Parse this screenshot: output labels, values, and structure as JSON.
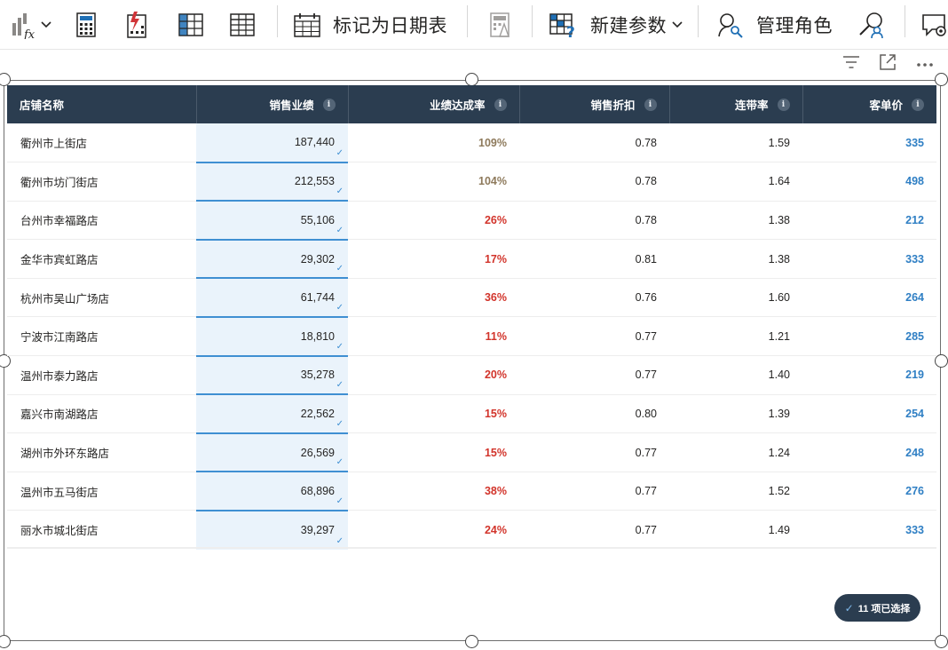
{
  "ribbon": {
    "mark_date_table_label": "标记为日期表",
    "new_param_label": "新建参数",
    "manage_roles_label": "管理角色",
    "icons": [
      "new-measure-fx-icon",
      "calculator-icon",
      "quick-measure-icon",
      "new-column-icon",
      "new-table-icon",
      "calendar-table-icon",
      "what-if-icon",
      "parameter-icon",
      "manage-roles-icon",
      "view-as-icon",
      "q-and-a-setup-icon"
    ]
  },
  "visual_header": {
    "icons": [
      "filter-icon",
      "focus-mode-icon",
      "more-options-icon"
    ]
  },
  "table": {
    "columns": [
      "店铺名称",
      "销售业绩",
      "业绩达成率",
      "销售折扣",
      "连带率",
      "客单价"
    ],
    "rows": [
      {
        "store": "衢州市上街店",
        "sales": "187,440",
        "rate": "109%",
        "discount": "0.78",
        "attach": "1.59",
        "price": "335"
      },
      {
        "store": "衢州市坊门街店",
        "sales": "212,553",
        "rate": "104%",
        "discount": "0.78",
        "attach": "1.64",
        "price": "498"
      },
      {
        "store": "台州市幸福路店",
        "sales": "55,106",
        "rate": "26%",
        "discount": "0.78",
        "attach": "1.38",
        "price": "212"
      },
      {
        "store": "金华市宾虹路店",
        "sales": "29,302",
        "rate": "17%",
        "discount": "0.81",
        "attach": "1.38",
        "price": "333"
      },
      {
        "store": "杭州市吴山广场店",
        "sales": "61,744",
        "rate": "36%",
        "discount": "0.76",
        "attach": "1.60",
        "price": "264"
      },
      {
        "store": "宁波市江南路店",
        "sales": "18,810",
        "rate": "11%",
        "discount": "0.77",
        "attach": "1.21",
        "price": "285"
      },
      {
        "store": "温州市泰力路店",
        "sales": "35,278",
        "rate": "20%",
        "discount": "0.77",
        "attach": "1.40",
        "price": "219"
      },
      {
        "store": "嘉兴市南湖路店",
        "sales": "22,562",
        "rate": "15%",
        "discount": "0.80",
        "attach": "1.39",
        "price": "254"
      },
      {
        "store": "湖州市外环东路店",
        "sales": "26,569",
        "rate": "15%",
        "discount": "0.77",
        "attach": "1.24",
        "price": "248"
      },
      {
        "store": "温州市五马街店",
        "sales": "68,896",
        "rate": "38%",
        "discount": "0.77",
        "attach": "1.52",
        "price": "276"
      },
      {
        "store": "丽水市城北街店",
        "sales": "39,297",
        "rate": "24%",
        "discount": "0.77",
        "attach": "1.49",
        "price": "333"
      }
    ]
  },
  "selection_badge": {
    "label": "11 项已选择"
  },
  "colors": {
    "header_bg": "#2b3d50",
    "sales_highlight": "#eaf3fb",
    "rate_high": "#8e7a5c",
    "rate_low": "#d2342b",
    "price": "#2f7fc4"
  }
}
